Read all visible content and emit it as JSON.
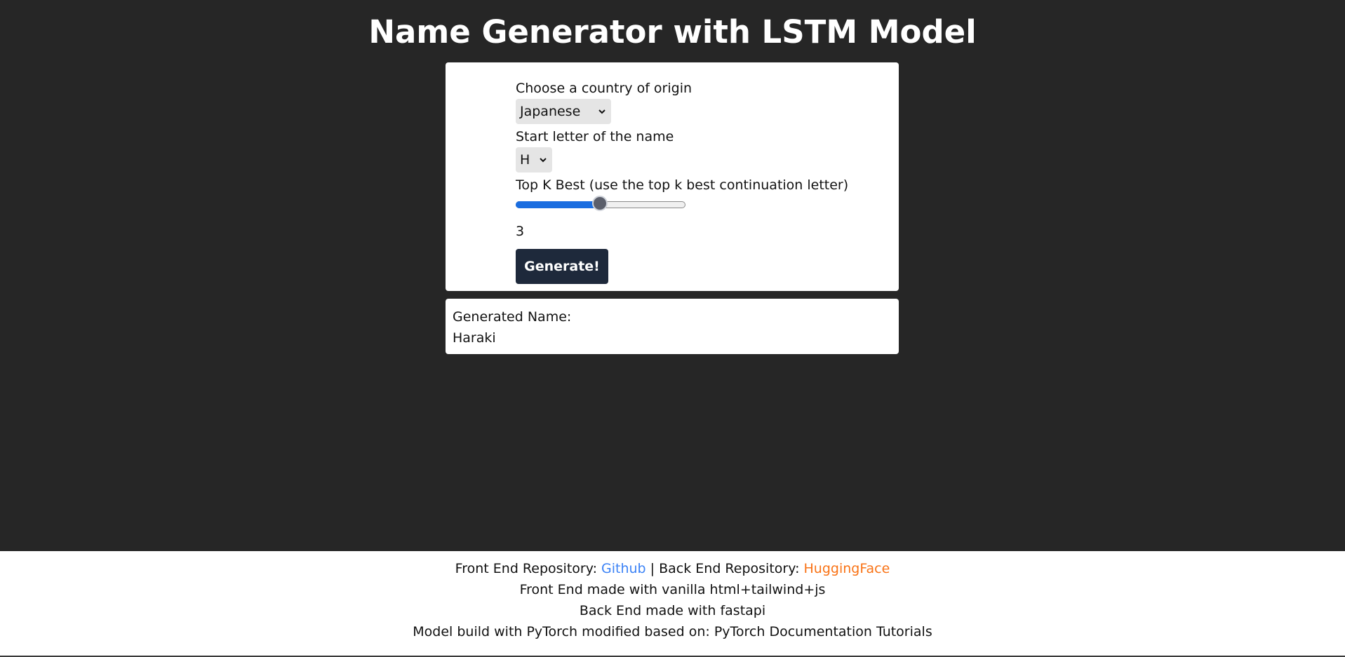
{
  "header": {
    "title": "Name Generator with LSTM Model"
  },
  "form": {
    "country_label": "Choose a country of origin",
    "country_selected": "Japanese",
    "letter_label": "Start letter of the name",
    "letter_selected": "H",
    "topk_label": "Top K Best (use the top k best continuation letter)",
    "topk_value": "3",
    "topk_fraction": 0.5,
    "generate_label": "Generate!"
  },
  "result": {
    "label": "Generated Name:",
    "value": "Haraki"
  },
  "footer": {
    "frontend_prefix": "Front End Repository: ",
    "frontend_link": "Github",
    "separator": " | ",
    "backend_prefix": "Back End Repository: ",
    "backend_link": "HuggingFace",
    "line2": "Front End made with vanilla html+tailwind+js",
    "line3": "Back End made with fastapi",
    "line4": "Model build with PyTorch modified based on: PyTorch Documentation Tutorials"
  },
  "colors": {
    "page_bg": "#262626",
    "button_bg": "#1e293b",
    "slider_fill": "#1a6de0",
    "link_github": "#3b82f6",
    "link_huggingface": "#f97316"
  }
}
